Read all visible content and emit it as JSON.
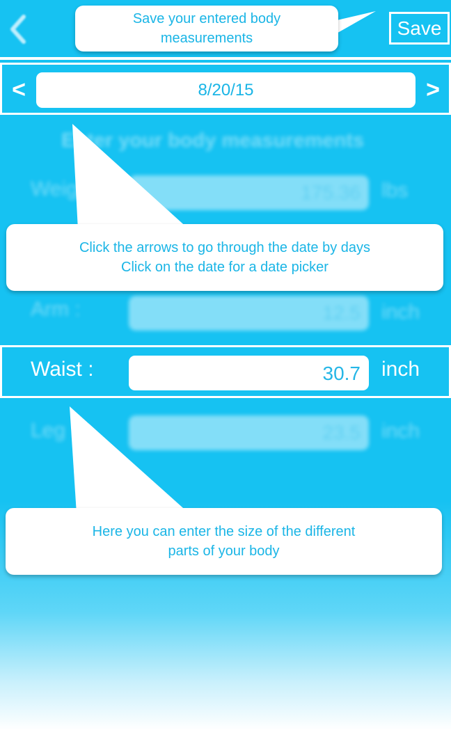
{
  "nav": {
    "save_label": "Save",
    "back_icon": "chevron-left-icon"
  },
  "date_bar": {
    "prev_label": "<",
    "date_value": "8/20/15",
    "next_label": ">"
  },
  "form": {
    "heading": "Enter your body measurements",
    "weight": {
      "label": "Weight :",
      "value": "175.36",
      "unit": "lbs"
    },
    "arm": {
      "label": "Arm :",
      "value": "12.5",
      "unit": "inch"
    },
    "waist": {
      "label": "Waist :",
      "value": "30.7",
      "unit": "inch"
    },
    "leg": {
      "label": "Leg :",
      "value": "23.5",
      "unit": "inch"
    }
  },
  "tips": {
    "save": {
      "line1": "Save your entered body",
      "line2": "measurements"
    },
    "date": {
      "line1": "Click the arrows to go through the date by days",
      "line2": "Click on the date for a date picker"
    },
    "body": {
      "line1": "Here you can enter the size of the different",
      "line2": "parts of your body"
    }
  },
  "colors": {
    "background": "#16c2f2",
    "accent_text": "#1ab5e6",
    "white": "#ffffff"
  }
}
